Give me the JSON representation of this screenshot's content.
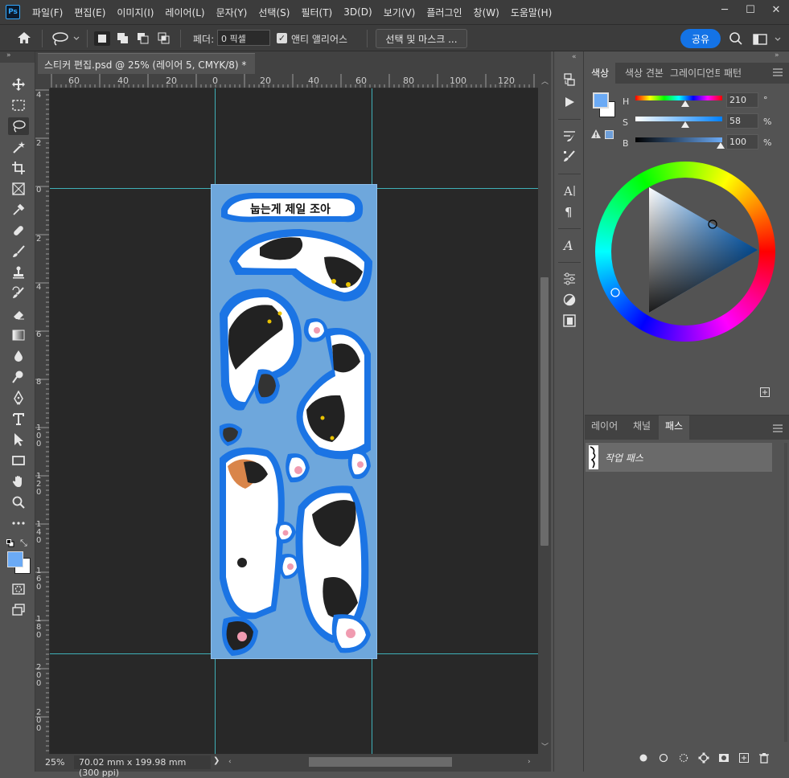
{
  "menu": {
    "logo": "Ps",
    "items": [
      "파일(F)",
      "편집(E)",
      "이미지(I)",
      "레이어(L)",
      "문자(Y)",
      "선택(S)",
      "필터(T)",
      "3D(D)",
      "보기(V)",
      "플러그인",
      "창(W)",
      "도움말(H)"
    ]
  },
  "window_controls": {
    "minimize": "─",
    "maximize": "☐",
    "close": "✕"
  },
  "options": {
    "feather_label": "페더:",
    "feather_value": "0 픽셀",
    "antialias_checked": true,
    "antialias_label": "앤티 앨리어스",
    "select_mask_label": "선택 및 마스크 ...",
    "share_label": "공유"
  },
  "document": {
    "tab_title": "스티커 편집.psd @ 25% (레이어 5, CMYK/8) *",
    "tab_close": "×",
    "ruler_top_labels": [
      "60",
      "40",
      "20",
      "0",
      "20",
      "40",
      "60",
      "80",
      "100",
      "120"
    ],
    "ruler_left_labels": [
      "4",
      "2",
      "0",
      "2",
      "4",
      "6",
      "8",
      "1 0 0",
      "1 2 0",
      "1 4 0",
      "1 6 0",
      "1 8 0",
      "2 0 0",
      "2 0 0"
    ],
    "sticker_title": "눕는게 제일 조아"
  },
  "status": {
    "zoom": "25%",
    "dimensions": "70.02 mm x 199.98 mm (300 ppi)",
    "arrow": "❯"
  },
  "color_panel": {
    "tabs": [
      "색상",
      "색상 견본",
      "그레이디언트",
      "패턴"
    ],
    "active_tab": "색상",
    "h_label": "H",
    "h_value": "210",
    "h_unit": "°",
    "s_label": "S",
    "s_value": "58",
    "s_unit": "%",
    "b_label": "B",
    "b_value": "100",
    "b_unit": "%",
    "foreground_color": "#6baaf5",
    "background_color": "#ffffff"
  },
  "paths_panel": {
    "tabs": [
      "레이어",
      "채널",
      "패스"
    ],
    "active_tab": "패스",
    "work_path_label": "작업 패스"
  },
  "colors": {
    "accent": "#1473e6",
    "guide": "#3fb0b8",
    "selection_fill": "#6ea7dc"
  }
}
